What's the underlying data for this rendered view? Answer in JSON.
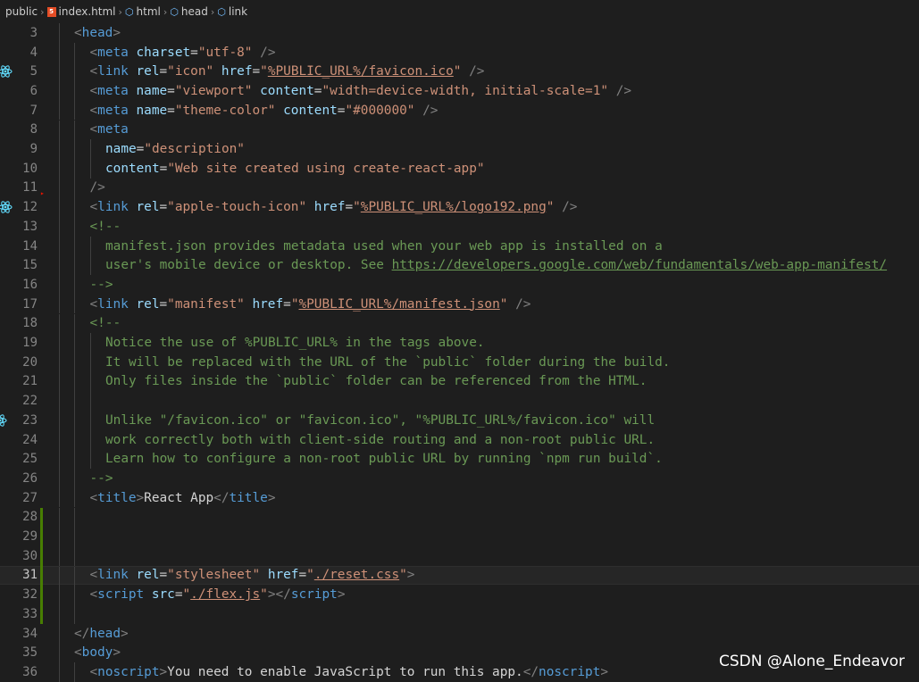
{
  "breadcrumb": {
    "items": [
      "public",
      "index.html",
      "html",
      "head",
      "link"
    ]
  },
  "watermark": "CSDN @Alone_Endeavor",
  "colors": {
    "tag": "#569cd6",
    "punct": "#808080",
    "attr": "#9cdcfe",
    "string": "#ce9178",
    "comment": "#6a9955",
    "text": "#d4d4d4",
    "modified_gutter": "#487e02"
  },
  "current_line": 31,
  "lines": [
    {
      "n": 3,
      "indent": 1,
      "tokens": [
        [
          "p",
          "<"
        ],
        [
          "t",
          "head"
        ],
        [
          "p",
          ">"
        ]
      ]
    },
    {
      "n": 4,
      "indent": 2,
      "tokens": [
        [
          "p",
          "<"
        ],
        [
          "t",
          "meta"
        ],
        [
          "x",
          " "
        ],
        [
          "a",
          "charset"
        ],
        [
          "x",
          "="
        ],
        [
          "s",
          "\"utf-8\""
        ],
        [
          "x",
          " "
        ],
        [
          "p",
          "/>"
        ]
      ]
    },
    {
      "n": 5,
      "indent": 2,
      "icon": "react",
      "tokens": [
        [
          "p",
          "<"
        ],
        [
          "t",
          "link"
        ],
        [
          "x",
          " "
        ],
        [
          "a",
          "rel"
        ],
        [
          "x",
          "="
        ],
        [
          "s",
          "\"icon\""
        ],
        [
          "x",
          " "
        ],
        [
          "a",
          "href"
        ],
        [
          "x",
          "="
        ],
        [
          "s",
          "\""
        ],
        [
          "su",
          "%PUBLIC_URL%/favicon.ico"
        ],
        [
          "s",
          "\""
        ],
        [
          "x",
          " "
        ],
        [
          "p",
          "/>"
        ]
      ]
    },
    {
      "n": 6,
      "indent": 2,
      "tokens": [
        [
          "p",
          "<"
        ],
        [
          "t",
          "meta"
        ],
        [
          "x",
          " "
        ],
        [
          "a",
          "name"
        ],
        [
          "x",
          "="
        ],
        [
          "s",
          "\"viewport\""
        ],
        [
          "x",
          " "
        ],
        [
          "a",
          "content"
        ],
        [
          "x",
          "="
        ],
        [
          "s",
          "\"width=device-width, initial-scale=1\""
        ],
        [
          "x",
          " "
        ],
        [
          "p",
          "/>"
        ]
      ]
    },
    {
      "n": 7,
      "indent": 2,
      "tokens": [
        [
          "p",
          "<"
        ],
        [
          "t",
          "meta"
        ],
        [
          "x",
          " "
        ],
        [
          "a",
          "name"
        ],
        [
          "x",
          "="
        ],
        [
          "s",
          "\"theme-color\""
        ],
        [
          "x",
          " "
        ],
        [
          "a",
          "content"
        ],
        [
          "x",
          "="
        ],
        [
          "s",
          "\"#000000\""
        ],
        [
          "x",
          " "
        ],
        [
          "p",
          "/>"
        ]
      ]
    },
    {
      "n": 8,
      "indent": 2,
      "tokens": [
        [
          "p",
          "<"
        ],
        [
          "t",
          "meta"
        ]
      ]
    },
    {
      "n": 9,
      "indent": 3,
      "tokens": [
        [
          "a",
          "name"
        ],
        [
          "x",
          "="
        ],
        [
          "s",
          "\"description\""
        ]
      ]
    },
    {
      "n": 10,
      "indent": 3,
      "tokens": [
        [
          "a",
          "content"
        ],
        [
          "x",
          "="
        ],
        [
          "s",
          "\"Web site created using create-react-app\""
        ]
      ]
    },
    {
      "n": 11,
      "indent": 2,
      "mark": "fold",
      "tokens": [
        [
          "p",
          "/>"
        ]
      ]
    },
    {
      "n": 12,
      "indent": 2,
      "icon": "react",
      "tokens": [
        [
          "p",
          "<"
        ],
        [
          "t",
          "link"
        ],
        [
          "x",
          " "
        ],
        [
          "a",
          "rel"
        ],
        [
          "x",
          "="
        ],
        [
          "s",
          "\"apple-touch-icon\""
        ],
        [
          "x",
          " "
        ],
        [
          "a",
          "href"
        ],
        [
          "x",
          "="
        ],
        [
          "s",
          "\""
        ],
        [
          "su",
          "%PUBLIC_URL%/logo192.png"
        ],
        [
          "s",
          "\""
        ],
        [
          "x",
          " "
        ],
        [
          "p",
          "/>"
        ]
      ]
    },
    {
      "n": 13,
      "indent": 2,
      "tokens": [
        [
          "c",
          "<!--"
        ]
      ]
    },
    {
      "n": 14,
      "indent": 3,
      "tokens": [
        [
          "c",
          "manifest.json provides metadata used when your web app is installed on a"
        ]
      ]
    },
    {
      "n": 15,
      "indent": 3,
      "tokens": [
        [
          "c",
          "user's mobile device or desktop. See "
        ],
        [
          "cu",
          "https://developers.google.com/web/fundamentals/web-app-manifest/"
        ]
      ]
    },
    {
      "n": 16,
      "indent": 2,
      "tokens": [
        [
          "c",
          "-->"
        ]
      ]
    },
    {
      "n": 17,
      "indent": 2,
      "tokens": [
        [
          "p",
          "<"
        ],
        [
          "t",
          "link"
        ],
        [
          "x",
          " "
        ],
        [
          "a",
          "rel"
        ],
        [
          "x",
          "="
        ],
        [
          "s",
          "\"manifest\""
        ],
        [
          "x",
          " "
        ],
        [
          "a",
          "href"
        ],
        [
          "x",
          "="
        ],
        [
          "s",
          "\""
        ],
        [
          "su",
          "%PUBLIC_URL%/manifest.json"
        ],
        [
          "s",
          "\""
        ],
        [
          "x",
          " "
        ],
        [
          "p",
          "/>"
        ]
      ]
    },
    {
      "n": 18,
      "indent": 2,
      "tokens": [
        [
          "c",
          "<!--"
        ]
      ]
    },
    {
      "n": 19,
      "indent": 3,
      "tokens": [
        [
          "c",
          "Notice the use of %PUBLIC_URL% in the tags above."
        ]
      ]
    },
    {
      "n": 20,
      "indent": 3,
      "tokens": [
        [
          "c",
          "It will be replaced with the URL of the `public` folder during the build."
        ]
      ]
    },
    {
      "n": 21,
      "indent": 3,
      "tokens": [
        [
          "c",
          "Only files inside the `public` folder can be referenced from the HTML."
        ]
      ]
    },
    {
      "n": 22,
      "indent": 3,
      "tokens": []
    },
    {
      "n": 23,
      "indent": 3,
      "icon": "react-partial",
      "tokens": [
        [
          "c",
          "Unlike \"/favicon.ico\" or \"favicon.ico\", \"%PUBLIC_URL%/favicon.ico\" will"
        ]
      ]
    },
    {
      "n": 24,
      "indent": 3,
      "tokens": [
        [
          "c",
          "work correctly both with client-side routing and a non-root public URL."
        ]
      ]
    },
    {
      "n": 25,
      "indent": 3,
      "tokens": [
        [
          "c",
          "Learn how to configure a non-root public URL by running `npm run build`."
        ]
      ]
    },
    {
      "n": 26,
      "indent": 2,
      "tokens": [
        [
          "c",
          "-->"
        ]
      ]
    },
    {
      "n": 27,
      "indent": 2,
      "tokens": [
        [
          "p",
          "<"
        ],
        [
          "t",
          "title"
        ],
        [
          "p",
          ">"
        ],
        [
          "x",
          "React App"
        ],
        [
          "p",
          "</"
        ],
        [
          "t",
          "title"
        ],
        [
          "p",
          ">"
        ]
      ]
    },
    {
      "n": 28,
      "indent": 2,
      "mod": true,
      "tokens": []
    },
    {
      "n": 29,
      "indent": 2,
      "mod": true,
      "tokens": []
    },
    {
      "n": 30,
      "indent": 2,
      "mod": true,
      "tokens": []
    },
    {
      "n": 31,
      "indent": 2,
      "mod": true,
      "tokens": [
        [
          "p",
          "<"
        ],
        [
          "t",
          "link"
        ],
        [
          "x",
          " "
        ],
        [
          "a",
          "rel"
        ],
        [
          "x",
          "="
        ],
        [
          "s",
          "\"stylesheet\""
        ],
        [
          "x",
          " "
        ],
        [
          "a",
          "href"
        ],
        [
          "x",
          "="
        ],
        [
          "s",
          "\""
        ],
        [
          "su",
          "./reset.css"
        ],
        [
          "s",
          "\""
        ],
        [
          "p",
          ">"
        ]
      ]
    },
    {
      "n": 32,
      "indent": 2,
      "mod": true,
      "tokens": [
        [
          "p",
          "<"
        ],
        [
          "t",
          "script"
        ],
        [
          "x",
          " "
        ],
        [
          "a",
          "src"
        ],
        [
          "x",
          "="
        ],
        [
          "s",
          "\""
        ],
        [
          "su",
          "./flex.js"
        ],
        [
          "s",
          "\""
        ],
        [
          "p",
          "></"
        ],
        [
          "t",
          "script"
        ],
        [
          "p",
          ">"
        ]
      ]
    },
    {
      "n": 33,
      "indent": 2,
      "mod": true,
      "tokens": []
    },
    {
      "n": 34,
      "indent": 1,
      "tokens": [
        [
          "p",
          "</"
        ],
        [
          "t",
          "head"
        ],
        [
          "p",
          ">"
        ]
      ]
    },
    {
      "n": 35,
      "indent": 1,
      "tokens": [
        [
          "p",
          "<"
        ],
        [
          "t",
          "body"
        ],
        [
          "p",
          ">"
        ]
      ]
    },
    {
      "n": 36,
      "indent": 2,
      "tokens": [
        [
          "p",
          "<"
        ],
        [
          "t",
          "noscript"
        ],
        [
          "p",
          ">"
        ],
        [
          "x",
          "You need to enable JavaScript to run this app."
        ],
        [
          "p",
          "</"
        ],
        [
          "t",
          "noscript"
        ],
        [
          "p",
          ">"
        ]
      ]
    }
  ]
}
